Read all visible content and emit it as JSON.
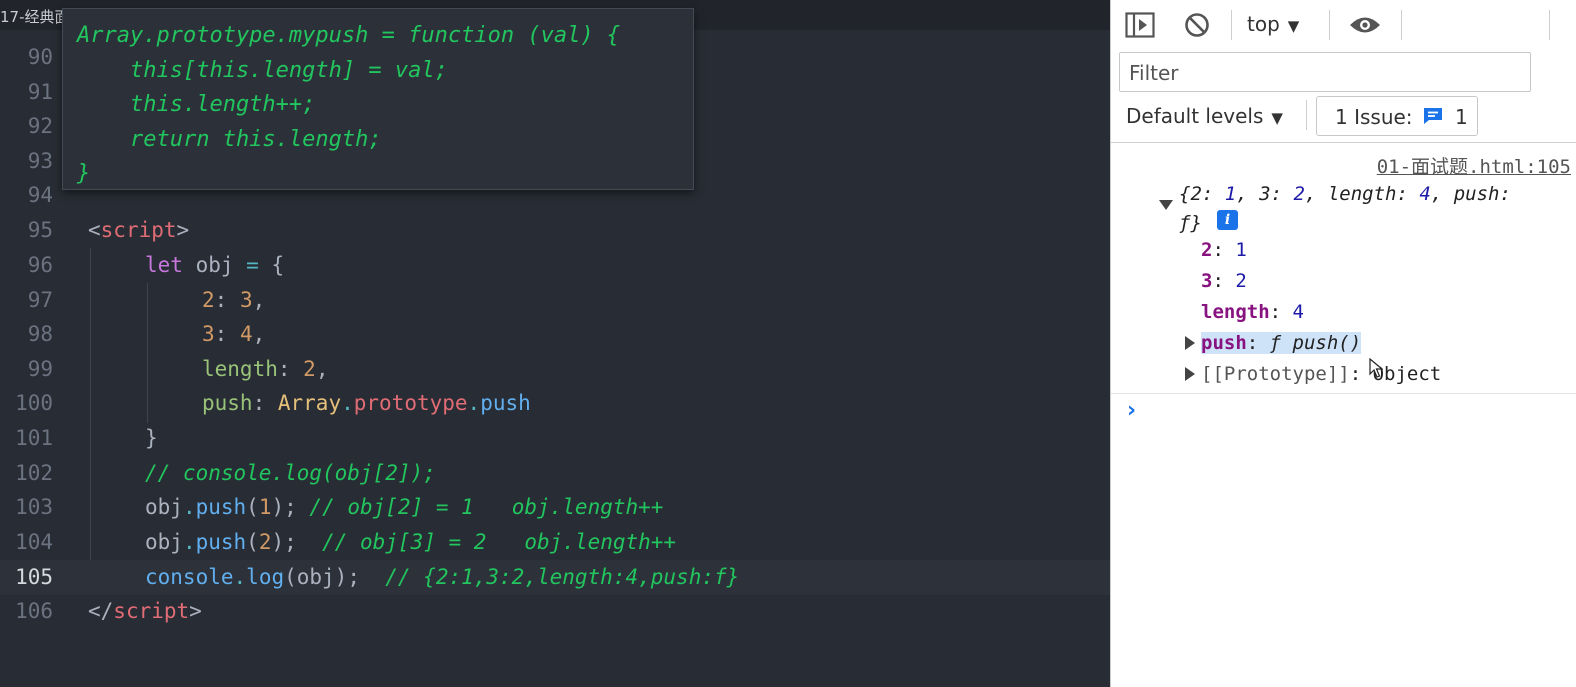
{
  "editor": {
    "tab_title": "17-经典面",
    "lines": [
      {
        "num": "90"
      },
      {
        "num": "91"
      },
      {
        "num": "92"
      },
      {
        "num": "93"
      },
      {
        "num": "94"
      },
      {
        "num": "95"
      },
      {
        "num": "96"
      },
      {
        "num": "97"
      },
      {
        "num": "98"
      },
      {
        "num": "99"
      },
      {
        "num": "100"
      },
      {
        "num": "101"
      },
      {
        "num": "102"
      },
      {
        "num": "103"
      },
      {
        "num": "104"
      },
      {
        "num": "105"
      },
      {
        "num": "106"
      }
    ],
    "code": {
      "l95": {
        "open": "<",
        "tag": "script",
        "close": ">"
      },
      "l96": {
        "kw": "let",
        "rest": " obj ",
        "op": "=",
        "brace": " {"
      },
      "l97": {
        "key": "2",
        "colon": ": ",
        "val": "3",
        "comma": ","
      },
      "l98": {
        "key": "3",
        "colon": ": ",
        "val": "4",
        "comma": ","
      },
      "l99": {
        "key": "length",
        "colon": ": ",
        "val": "2",
        "comma": ","
      },
      "l100": {
        "key": "push",
        "colon": ": ",
        "cls": "Array",
        "dot1": ".",
        "prop": "prototype",
        "dot2": ".",
        "fn": "push"
      },
      "l101": {
        "text": "}"
      },
      "l102": {
        "comment": "// console.log(obj[2]);"
      },
      "l103": {
        "obj": "obj",
        "dot": ".",
        "fn": "push",
        "p1": "(",
        "arg": "1",
        "p2": ");",
        "comment": " // obj[2] = 1   obj.length++"
      },
      "l104": {
        "obj": "obj",
        "dot": ".",
        "fn": "push",
        "p1": "(",
        "arg": "2",
        "p2": ");",
        "comment": "  // obj[3] = 2   obj.length++"
      },
      "l105": {
        "obj": "console",
        "dot": ".",
        "fn": "log",
        "args": "(obj);",
        "comment": "  // {2:1,3:2,length:4,push:f}"
      },
      "l106": {
        "open": "</",
        "tag": "script",
        "close": ">"
      }
    },
    "popup_lines": [
      "Array.prototype.mypush = function (val) {",
      "    this[this.length] = val;",
      "    this.length++;",
      "    return this.length;",
      "}"
    ]
  },
  "devtools": {
    "context": "top",
    "filter_placeholder": "Filter",
    "levels": "Default levels",
    "issues_label": "1 Issue:",
    "issues_count": "1",
    "source_link": "01-面试题.html:105",
    "summary": {
      "open": "{",
      "k1": "2",
      "v1": "1",
      "k2": "3",
      "v2": "2",
      "k3": "length",
      "v3": "4",
      "k4": "push",
      "tail": "ƒ}"
    },
    "info_badge": "i",
    "props": [
      {
        "key": "2",
        "value": "1"
      },
      {
        "key": "3",
        "value": "2"
      },
      {
        "key": "length",
        "value": "4"
      }
    ],
    "push_row": {
      "key": "push",
      "value": "ƒ push()"
    },
    "prototype_row": {
      "key": "[[Prototype]]",
      "value": "Object"
    },
    "prompt": "›",
    "colors": {
      "accent": "#1a73e8",
      "highlight": "#cfe3f8"
    }
  }
}
